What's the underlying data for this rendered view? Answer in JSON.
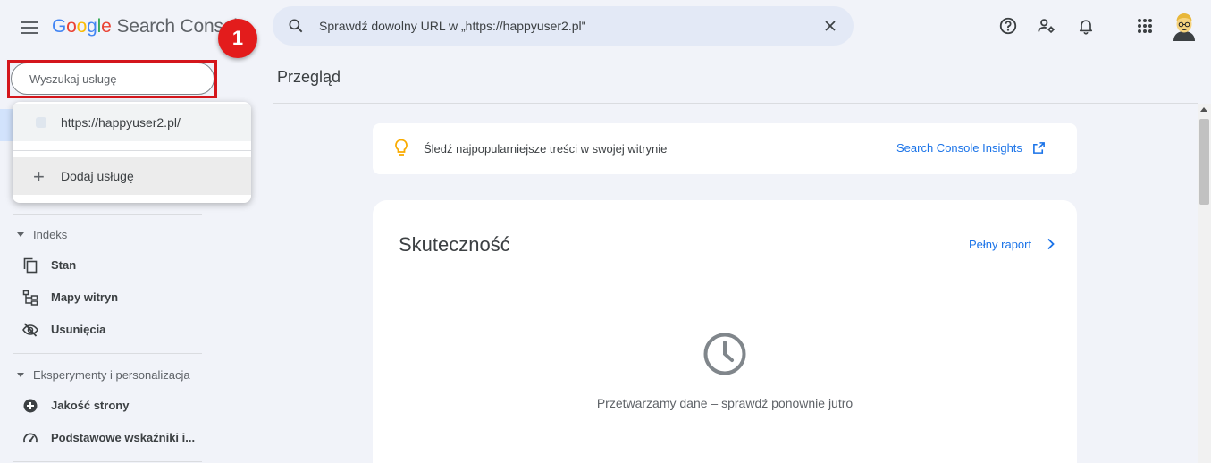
{
  "header": {
    "logo_letters": [
      "G",
      "o",
      "o",
      "g",
      "l",
      "e"
    ],
    "product_name": "Search Console",
    "annotation_number": "1",
    "url_inspect_text": "Sprawdź dowolny URL w „https://happyuser2.pl\""
  },
  "sidebar": {
    "search_placeholder": "Wyszukaj usługę",
    "dropdown": {
      "property": "https://happyuser2.pl/",
      "add_property": "Dodaj usługę"
    },
    "sections": [
      {
        "label": "Indeks",
        "items": [
          {
            "label": "Stan",
            "icon": "pages-icon"
          },
          {
            "label": "Mapy witryn",
            "icon": "sitemap-icon"
          },
          {
            "label": "Usunięcia",
            "icon": "removals-icon"
          }
        ]
      },
      {
        "label": "Eksperymenty i personalizacja",
        "items": [
          {
            "label": "Jakość strony",
            "icon": "page-experience-icon"
          },
          {
            "label": "Podstawowe wskaźniki i...",
            "icon": "core-web-vitals-icon"
          }
        ]
      }
    ]
  },
  "main": {
    "title": "Przegląd",
    "insights": {
      "text": "Śledź najpopularniejsze treści w swojej witrynie",
      "link": "Search Console Insights"
    },
    "performance": {
      "title": "Skuteczność",
      "link": "Pełny raport",
      "message": "Przetwarzamy dane – sprawdź ponownie jutro"
    }
  },
  "colors": {
    "accent": "#1a73e8",
    "annotation_red": "#e31c1c",
    "background": "#f1f3f9"
  }
}
